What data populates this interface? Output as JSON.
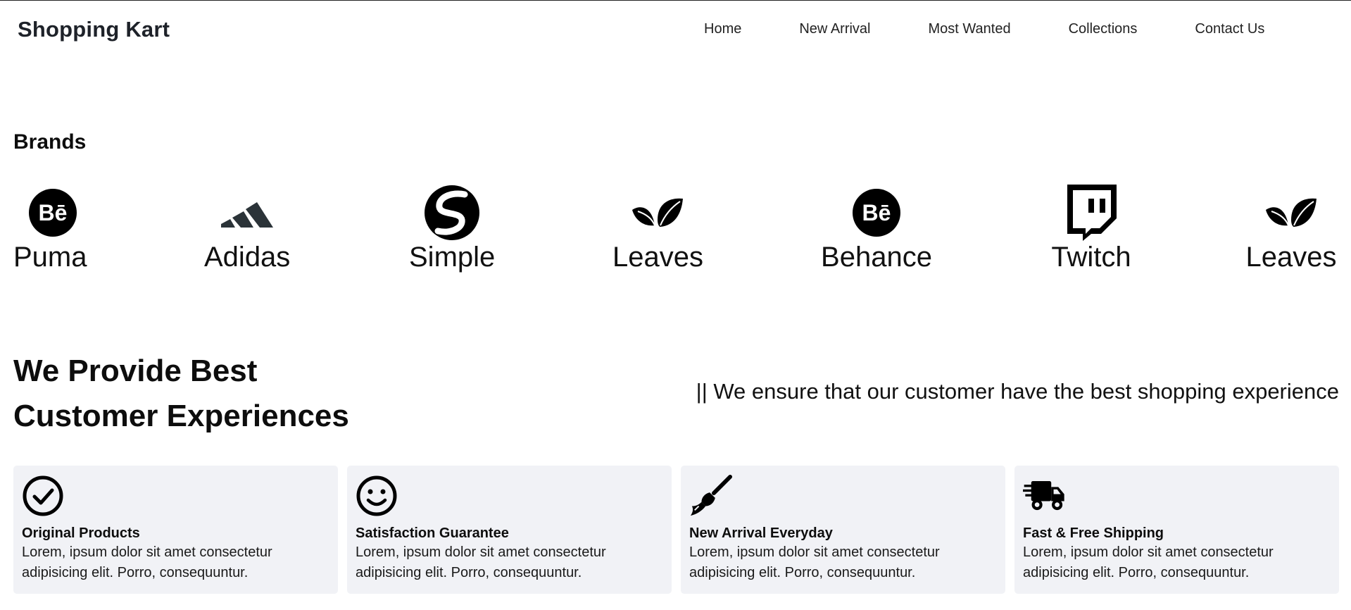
{
  "header": {
    "logo": "Shopping Kart",
    "nav": [
      {
        "label": "Home"
      },
      {
        "label": "New Arrival"
      },
      {
        "label": "Most Wanted"
      },
      {
        "label": "Collections"
      },
      {
        "label": "Contact Us"
      }
    ]
  },
  "brands": {
    "title": "Brands",
    "items": [
      {
        "name": "Puma",
        "icon": "behance-icon"
      },
      {
        "name": "Adidas",
        "icon": "adidas-icon"
      },
      {
        "name": "Simple",
        "icon": "simple-icon"
      },
      {
        "name": "Leaves",
        "icon": "leaves-icon"
      },
      {
        "name": "Behance",
        "icon": "behance-icon"
      },
      {
        "name": "Twitch",
        "icon": "twitch-icon"
      },
      {
        "name": "Leaves",
        "icon": "leaves-icon"
      }
    ]
  },
  "provide": {
    "title_line1": "We Provide Best",
    "title_line2": "Customer Experiences",
    "tagline": "|| We ensure that our customer have the best shopping experience"
  },
  "features": [
    {
      "title": "Original Products",
      "desc": "Lorem, ipsum dolor sit amet consectetur adipisicing elit. Porro, consequuntur.",
      "icon": "check-circle-icon"
    },
    {
      "title": "Satisfaction Guarantee",
      "desc": "Lorem, ipsum dolor sit amet consectetur adipisicing elit. Porro, consequuntur.",
      "icon": "smile-icon"
    },
    {
      "title": "New Arrival Everyday",
      "desc": "Lorem, ipsum dolor sit amet consectetur adipisicing elit. Porro, consequuntur.",
      "icon": "broom-icon"
    },
    {
      "title": "Fast & Free Shipping",
      "desc": "Lorem, ipsum dolor sit amet consectetur adipisicing elit. Porro, consequuntur.",
      "icon": "truck-fast-icon"
    }
  ],
  "colors": {
    "text": "#111111",
    "logo": "#1e2229",
    "card_bg": "#f1f2f6",
    "adidas": "#2b3338"
  }
}
